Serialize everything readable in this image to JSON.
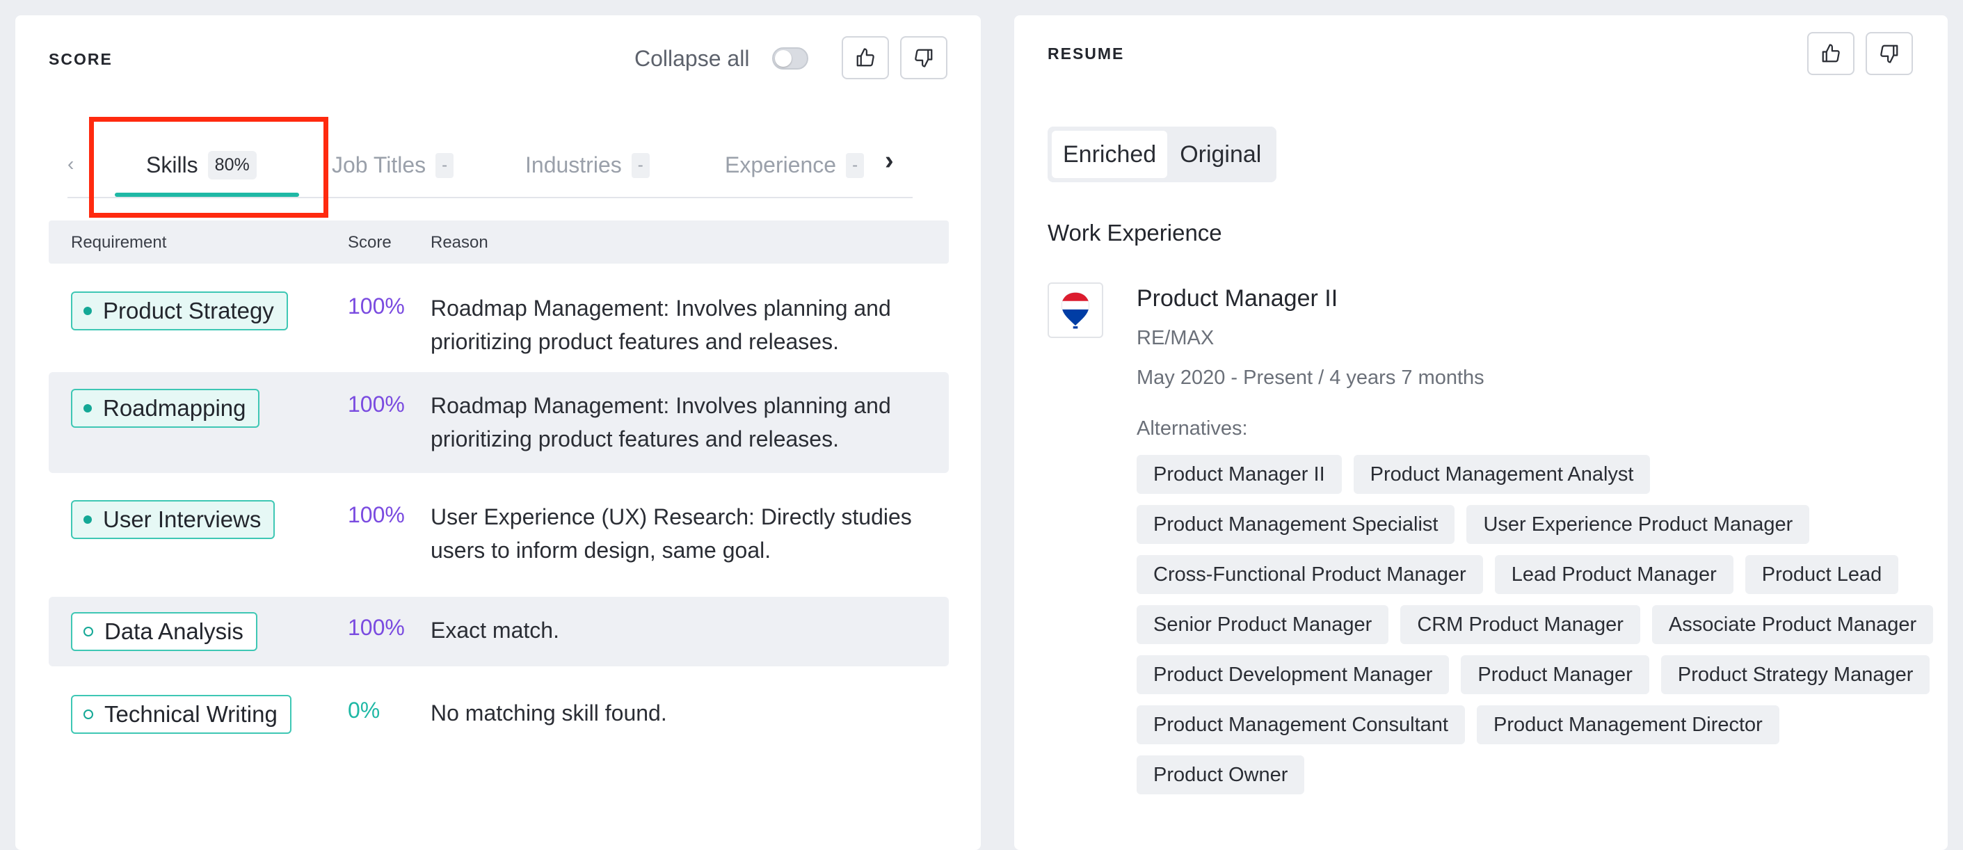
{
  "score_panel": {
    "title": "SCORE",
    "collapse_label": "Collapse all",
    "tabs": [
      {
        "label": "Skills",
        "badge": "80%"
      },
      {
        "label": "Job Titles",
        "badge": "-"
      },
      {
        "label": "Industries",
        "badge": "-"
      },
      {
        "label": "Experience",
        "badge": "-"
      }
    ],
    "table": {
      "headers": [
        "Requirement",
        "Score",
        "Reason"
      ],
      "rows": [
        {
          "requirement": "Product Strategy",
          "score": "100%",
          "reason": "Roadmap Management: Involves planning and prioritizing product features and releases."
        },
        {
          "requirement": "Roadmapping",
          "score": "100%",
          "reason": "Roadmap Management: Involves planning and prioritizing product features and releases."
        },
        {
          "requirement": "User Interviews",
          "score": "100%",
          "reason": "User Experience (UX) Research: Directly studies users to inform design, same goal."
        },
        {
          "requirement": "Data Analysis",
          "score": "100%",
          "reason": "Exact match."
        },
        {
          "requirement": "Technical Writing",
          "score": "0%",
          "reason": "No matching skill found."
        }
      ]
    }
  },
  "resume_panel": {
    "title": "RESUME",
    "view_toggle": [
      "Enriched",
      "Original"
    ],
    "section_title": "Work Experience",
    "job": {
      "logo_text": "RE/MAX",
      "title": "Product Manager II",
      "company": "RE/MAX",
      "dates": "May 2020 - Present / 4 years 7 months",
      "alternatives_label": "Alternatives:",
      "alternatives": [
        "Product Manager II",
        "Product Management Analyst",
        "Product Management Specialist",
        "User Experience Product Manager",
        "Cross-Functional Product Manager",
        "Lead Product Manager",
        "Product Lead",
        "Senior Product Manager",
        "CRM Product Manager",
        "Associate Product Manager",
        "Product Development Manager",
        "Product Manager",
        "Product Strategy Manager",
        "Product Management Consultant",
        "Product Management Director",
        "Product Owner"
      ]
    }
  },
  "icons": {
    "thumbs_up": "thumbs-up-icon",
    "thumbs_down": "thumbs-down-icon",
    "chevron_right": "chevron-right-icon",
    "chevron_left": "chevron-left-icon"
  },
  "colors": {
    "accent_teal": "#1fb8a5",
    "score_purple": "#7a4be0",
    "highlight_red": "#ff2a0f"
  }
}
